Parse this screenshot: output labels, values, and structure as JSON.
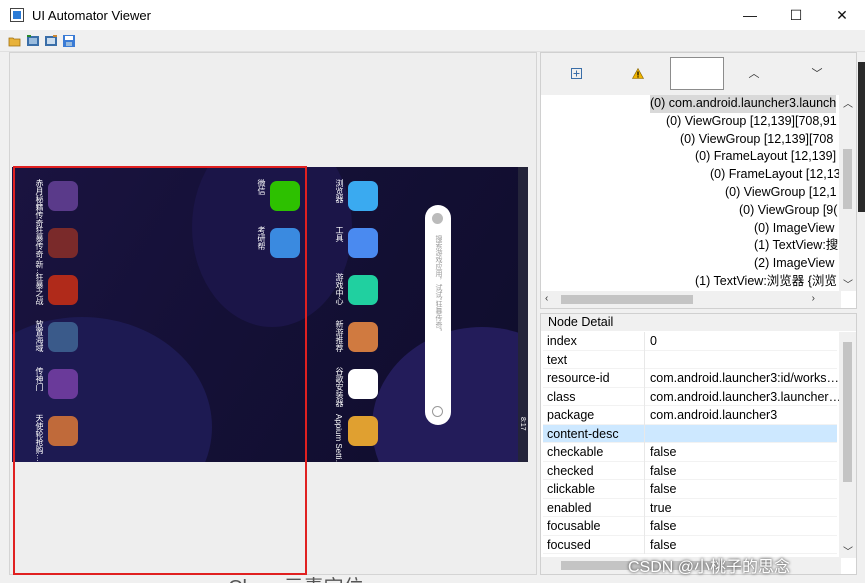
{
  "window": {
    "title": "UI Automator Viewer",
    "controls": {
      "minimize": "—",
      "maximize": "☐",
      "close": "✕"
    }
  },
  "toolbar": {
    "icons": [
      "open-folder-icon",
      "device-screenshot-icon",
      "device-screenshot-compressed-icon",
      "save-icon"
    ]
  },
  "device": {
    "left_apps": [
      {
        "label": "赤月秘籍传奇",
        "color": "#5a3a8a"
      },
      {
        "label": "狂暴传奇-新…",
        "color": "#7a2a2a"
      },
      {
        "label": "狂暴之战",
        "color": "#b02a1a"
      },
      {
        "label": "放置海域",
        "color": "#3a5a8a"
      },
      {
        "label": "传神门",
        "color": "#6a3a9a"
      },
      {
        "label": "天使轮抢购…",
        "color": "#c06a3a"
      }
    ],
    "mid_apps": [
      {
        "label": "微信",
        "color": "#2dc100"
      },
      {
        "label": "考研帮",
        "color": "#3a8ae0"
      }
    ],
    "right_apps": [
      {
        "label": "浏览器",
        "color": "#3aaaf0"
      },
      {
        "label": "工具",
        "color": "#4a8af0"
      },
      {
        "label": "游戏中心",
        "color": "#20d0a0"
      },
      {
        "label": "新游推荐",
        "color": "#d07a40"
      },
      {
        "label": "谷歌安装器",
        "color": "#ffffff"
      },
      {
        "label": "Appium Setti…",
        "color": "#e0a030"
      }
    ],
    "search_hint": "搜索游戏应用，试试“狂暴传奇”",
    "status_text": "8:17"
  },
  "tree": {
    "toolbar_icons": [
      "expand-all-icon",
      "warning-icon",
      "previous-icon",
      "next-icon"
    ],
    "rows": [
      {
        "text": "(0) com.android.launcher3.launch",
        "indent": 105,
        "selected": true
      },
      {
        "text": "(0) ViewGroup [12,139][708,91",
        "indent": 121,
        "selected": false
      },
      {
        "text": "(0) ViewGroup [12,139][708",
        "indent": 135,
        "selected": false
      },
      {
        "text": "(0) FrameLayout [12,139]",
        "indent": 150,
        "selected": false
      },
      {
        "text": "(0) FrameLayout [12,13",
        "indent": 165,
        "selected": false
      },
      {
        "text": "(0) ViewGroup [12,1",
        "indent": 180,
        "selected": false
      },
      {
        "text": "(0) ViewGroup [9(",
        "indent": 194,
        "selected": false
      },
      {
        "text": "(0) ImageView",
        "indent": 209,
        "selected": false
      },
      {
        "text": "(1) TextView:搜",
        "indent": 209,
        "selected": false
      },
      {
        "text": "(2) ImageView",
        "indent": 209,
        "selected": false
      },
      {
        "text": "(1) TextView:浏览器 {浏览",
        "indent": 150,
        "selected": false
      }
    ]
  },
  "node_detail": {
    "header": "Node Detail",
    "rows": [
      {
        "key": "index",
        "value": "0",
        "selected": false
      },
      {
        "key": "text",
        "value": "",
        "selected": false
      },
      {
        "key": "resource-id",
        "value": "com.android.launcher3:id/works…",
        "selected": false
      },
      {
        "key": "class",
        "value": "com.android.launcher3.launcher…",
        "selected": false
      },
      {
        "key": "package",
        "value": "com.android.launcher3",
        "selected": false
      },
      {
        "key": "content-desc",
        "value": "",
        "selected": true
      },
      {
        "key": "checkable",
        "value": "false",
        "selected": false
      },
      {
        "key": "checked",
        "value": "false",
        "selected": false
      },
      {
        "key": "clickable",
        "value": "false",
        "selected": false
      },
      {
        "key": "enabled",
        "value": "true",
        "selected": false
      },
      {
        "key": "focusable",
        "value": "false",
        "selected": false
      },
      {
        "key": "focused",
        "value": "false",
        "selected": false
      }
    ]
  },
  "watermark": "CSDN @小桃子的思念",
  "behind_text": "Class:元素定位",
  "colors": {
    "selection_rect": "#e02020",
    "selected_row": "#cde8ff",
    "device_bg": "#141036"
  }
}
